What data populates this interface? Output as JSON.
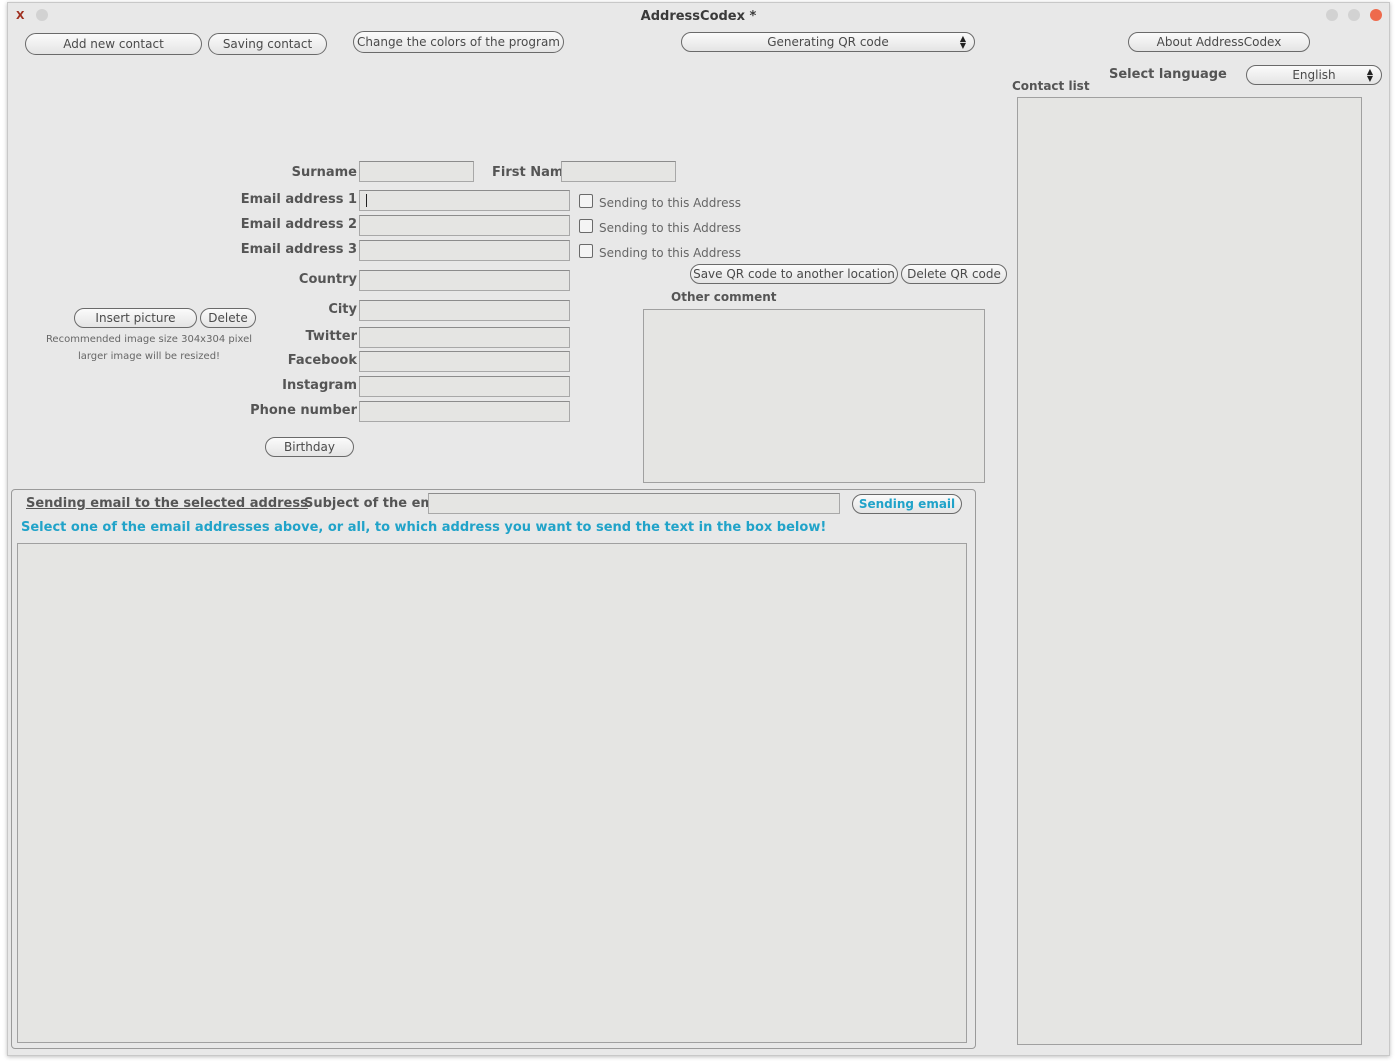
{
  "window": {
    "title": "AddressCodex *",
    "app_icon": "X"
  },
  "toolbar": {
    "add_contact": "Add new contact",
    "save_contact": "Saving contact",
    "change_colors": "Change the colors of the program",
    "qr_combo": "Generating QR code",
    "about": "About AddressCodex"
  },
  "language": {
    "label": "Select language",
    "value": "English"
  },
  "contact_list": {
    "label": "Contact list"
  },
  "form": {
    "surname_label": "Surname",
    "first_name_label": "First Name",
    "email1_label": "Email address 1",
    "email2_label": "Email address 2",
    "email3_label": "Email address 3",
    "send_check_label": "Sending to this Address",
    "country_label": "Country",
    "city_label": "City",
    "twitter_label": "Twitter",
    "facebook_label": "Facebook",
    "instagram_label": "Instagram",
    "phone_label": "Phone number",
    "birthday_button": "Birthday"
  },
  "picture": {
    "insert": "Insert picture",
    "delete": "Delete",
    "hint1": "Recommended image size 304x304 pixel",
    "hint2": "larger image will be resized!"
  },
  "qr": {
    "save": "Save QR code to another location",
    "delete": "Delete QR code"
  },
  "comment": {
    "label": "Other comment"
  },
  "email_section": {
    "title": "Sending email to the selected address",
    "subject_label": "Subject of the email",
    "send_button": "Sending email",
    "instruction": "Select one of the email addresses above, or all, to which address you want to send the text in the box below!"
  },
  "colors": {
    "accent": "#21a3c9",
    "close": "#ee6a4c",
    "background": "#e8e8e8"
  }
}
